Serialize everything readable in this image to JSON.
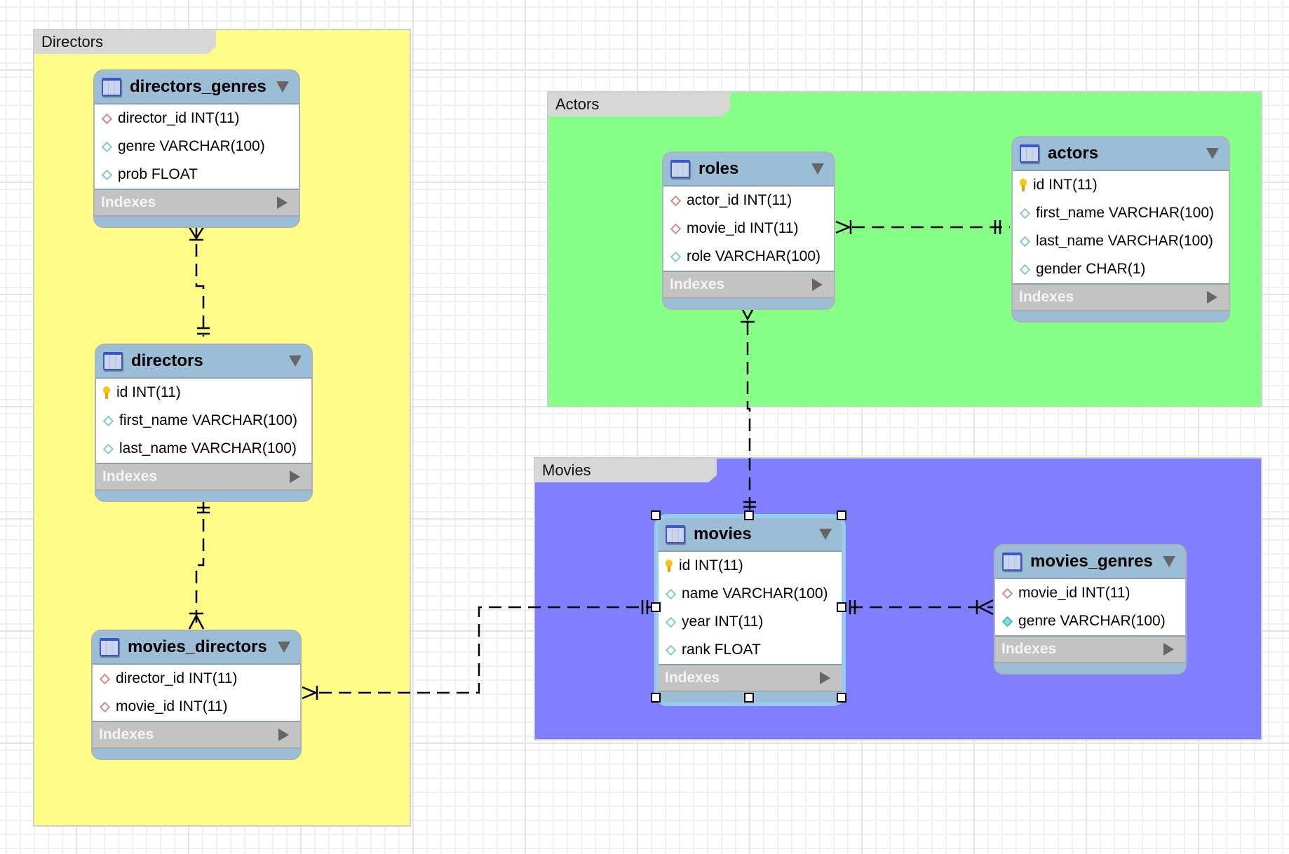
{
  "layers": [
    {
      "id": "directors",
      "label": "Directors",
      "color": "#fffb87"
    },
    {
      "id": "actors",
      "label": "Actors",
      "color": "#87ff87"
    },
    {
      "id": "movies",
      "label": "Movies",
      "color": "#8080ff"
    }
  ],
  "indexes_label": "Indexes",
  "tables": {
    "directors_genres": {
      "name": "directors_genres",
      "columns": [
        {
          "text": "director_id INT(11)",
          "kind": "fk"
        },
        {
          "text": "genre VARCHAR(100)",
          "kind": "col"
        },
        {
          "text": "prob FLOAT",
          "kind": "col"
        }
      ]
    },
    "directors": {
      "name": "directors",
      "columns": [
        {
          "text": "id INT(11)",
          "kind": "pk"
        },
        {
          "text": "first_name VARCHAR(100)",
          "kind": "col"
        },
        {
          "text": "last_name VARCHAR(100)",
          "kind": "col"
        }
      ]
    },
    "movies_directors": {
      "name": "movies_directors",
      "columns": [
        {
          "text": "director_id INT(11)",
          "kind": "fk"
        },
        {
          "text": "movie_id INT(11)",
          "kind": "fk"
        }
      ]
    },
    "roles": {
      "name": "roles",
      "columns": [
        {
          "text": "actor_id INT(11)",
          "kind": "fk"
        },
        {
          "text": "movie_id INT(11)",
          "kind": "fk"
        },
        {
          "text": "role VARCHAR(100)",
          "kind": "col"
        }
      ]
    },
    "actors": {
      "name": "actors",
      "columns": [
        {
          "text": "id INT(11)",
          "kind": "pk"
        },
        {
          "text": "first_name VARCHAR(100)",
          "kind": "col"
        },
        {
          "text": "last_name VARCHAR(100)",
          "kind": "col"
        },
        {
          "text": "gender CHAR(1)",
          "kind": "col"
        }
      ]
    },
    "movies": {
      "name": "movies",
      "selected": true,
      "columns": [
        {
          "text": "id INT(11)",
          "kind": "pk"
        },
        {
          "text": "name VARCHAR(100)",
          "kind": "col"
        },
        {
          "text": "year INT(11)",
          "kind": "col"
        },
        {
          "text": "rank FLOAT",
          "kind": "col"
        }
      ]
    },
    "movies_genres": {
      "name": "movies_genres",
      "columns": [
        {
          "text": "movie_id INT(11)",
          "kind": "fk"
        },
        {
          "text": "genre VARCHAR(100)",
          "kind": "idx"
        }
      ]
    }
  },
  "relationships": [
    {
      "from": "directors_genres",
      "to": "directors",
      "from_card": "many",
      "to_card": "one"
    },
    {
      "from": "movies_directors",
      "to": "directors",
      "from_card": "many",
      "to_card": "one"
    },
    {
      "from": "movies_directors",
      "to": "movies",
      "from_card": "many",
      "to_card": "one"
    },
    {
      "from": "roles",
      "to": "actors",
      "from_card": "many",
      "to_card": "one"
    },
    {
      "from": "roles",
      "to": "movies",
      "from_card": "many",
      "to_card": "one"
    },
    {
      "from": "movies_genres",
      "to": "movies",
      "from_card": "many",
      "to_card": "one"
    }
  ]
}
